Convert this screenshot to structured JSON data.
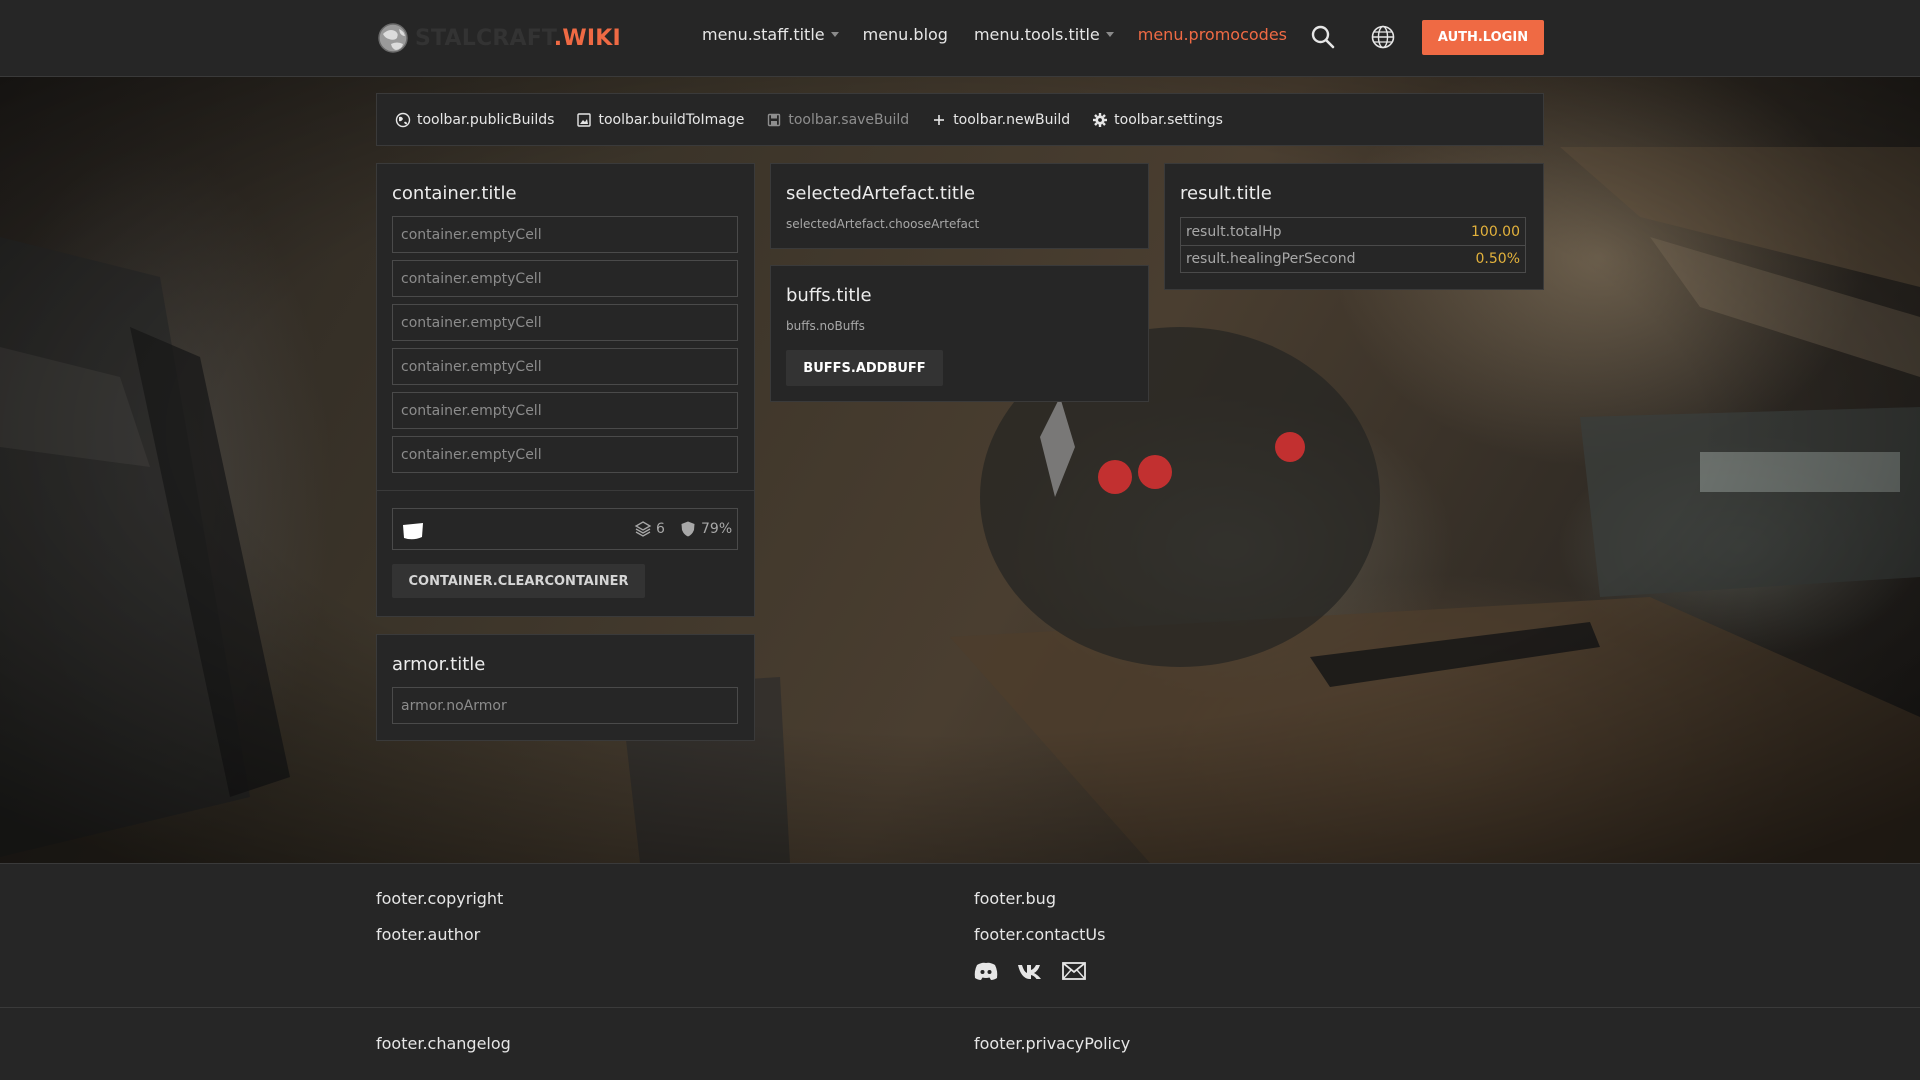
{
  "header": {
    "logo": {
      "part1": "STALCRAFT",
      "part2": ".WIKI"
    },
    "nav": [
      {
        "label": "menu.staff.title",
        "dropdown": true,
        "active": false
      },
      {
        "label": "menu.blog",
        "dropdown": false,
        "active": false
      },
      {
        "label": "menu.tools.title",
        "dropdown": true,
        "active": false
      },
      {
        "label": "menu.promocodes",
        "dropdown": false,
        "active": true
      }
    ],
    "search_icon": "search-icon",
    "language_icon": "globe-icon",
    "login_label": "AUTH.LOGIN"
  },
  "toolbar": {
    "items": [
      {
        "label": "toolbar.publicBuilds",
        "icon": "public-builds-icon",
        "disabled": false
      },
      {
        "label": "toolbar.buildToImage",
        "icon": "image-icon",
        "disabled": false
      },
      {
        "label": "toolbar.saveBuild",
        "icon": "save-icon",
        "disabled": true
      },
      {
        "label": "toolbar.newBuild",
        "icon": "plus-icon",
        "disabled": false
      },
      {
        "label": "toolbar.settings",
        "icon": "gear-icon",
        "disabled": false
      }
    ]
  },
  "container": {
    "title": "container.title",
    "cells": [
      "container.emptyCell",
      "container.emptyCell",
      "container.emptyCell",
      "container.emptyCell",
      "container.emptyCell",
      "container.emptyCell"
    ],
    "stats": {
      "layers": "6",
      "protection": "79%"
    },
    "clear_label": "CONTAINER.CLEARCONTAINER"
  },
  "armor": {
    "title": "armor.title",
    "placeholder": "armor.noArmor"
  },
  "selectedArtefact": {
    "title": "selectedArtefact.title",
    "hint": "selectedArtefact.chooseArtefact"
  },
  "buffs": {
    "title": "buffs.title",
    "empty": "buffs.noBuffs",
    "add_label": "BUFFS.ADDBUFF"
  },
  "result": {
    "title": "result.title",
    "rows": [
      {
        "label": "result.totalHp",
        "value": "100.00"
      },
      {
        "label": "result.healingPerSecond",
        "value": "0.50%"
      }
    ]
  },
  "footer": {
    "copyright": "footer.copyright",
    "author": "footer.author",
    "bug": "footer.bug",
    "contactUs": "footer.contactUs",
    "changelog": "footer.changelog",
    "privacyPolicy": "footer.privacyPolicy",
    "social": [
      "discord-icon",
      "vk-icon",
      "mail-icon"
    ]
  },
  "colors": {
    "accent": "#ef6a44",
    "value": "#e3b23c",
    "panel": "#262626",
    "border": "#3a3a3a"
  }
}
